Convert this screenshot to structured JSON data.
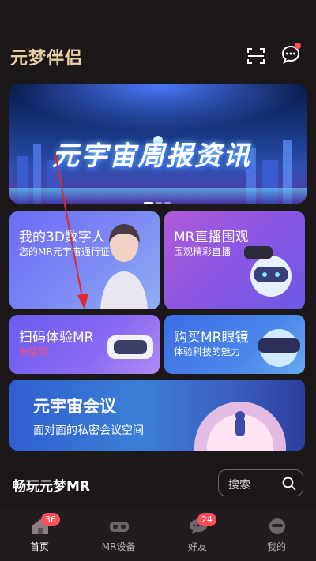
{
  "header": {
    "logo_text": "元梦伴侣",
    "scan_icon": "scan-icon",
    "message_icon": "message-icon",
    "message_has_dot": true
  },
  "banner": {
    "title": "元宇宙周报资讯",
    "slides": 3,
    "active_slide": 1
  },
  "cards": {
    "digital_human": {
      "title": "我的3D数字人",
      "subtitle": "您的MR元宇宙通行证"
    },
    "mr_live": {
      "title": "MR直播围观",
      "subtitle": "围观精彩直播"
    },
    "scan_mr": {
      "title": "扫码体验MR",
      "subtitle": "未使用"
    },
    "buy_glasses": {
      "title": "购买MR眼镜",
      "subtitle": "体验科技的魅力"
    },
    "meeting": {
      "title": "元宇宙会议",
      "subtitle": "面对面的私密会议空间"
    }
  },
  "section": {
    "title": "畅玩元梦MR",
    "search_placeholder": "搜索"
  },
  "tabbar": {
    "items": [
      {
        "label": "首页",
        "icon": "home-icon",
        "badge": "36",
        "active": true
      },
      {
        "label": "MR设备",
        "icon": "vr-headset-icon",
        "badge": "",
        "active": false
      },
      {
        "label": "好友",
        "icon": "chat-bubble-icon",
        "badge": "24",
        "active": false
      },
      {
        "label": "我的",
        "icon": "profile-icon",
        "badge": "",
        "active": false
      }
    ]
  },
  "colors": {
    "background": "#1c1718",
    "logo": "#e8cfa4",
    "badge": "#ff4d5a",
    "red_annotation": "#e1262b"
  }
}
